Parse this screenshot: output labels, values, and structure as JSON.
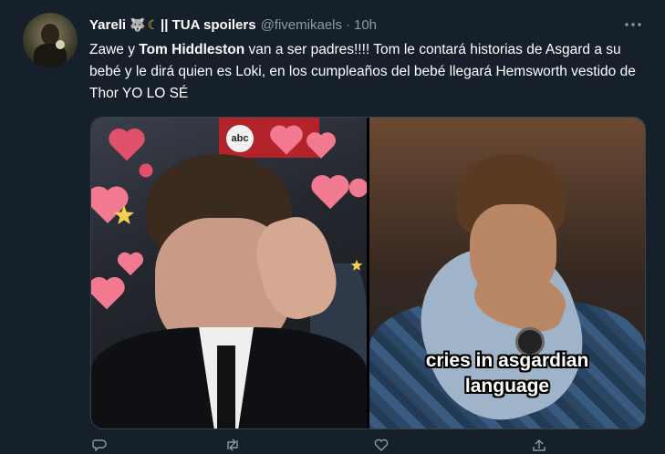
{
  "tweet": {
    "display_name": "Yareli",
    "name_suffix": "|| TUA spoilers",
    "handle": "@fivemikaels",
    "separator": "·",
    "time": "10h",
    "text": {
      "p1": "Zawe  y ",
      "bold": "Tom Hiddleston",
      "p2": " van a ser padres!!!! Tom le contará historias de Asgard a su bebé y le dirá quien es Loki, en los cumpleaños del bebé llegará Hemsworth vestido de Thor YO LO SÉ"
    }
  },
  "media": {
    "left_sign_text": "abc",
    "caption_line1": "cries in asgardian",
    "caption_line2": "language"
  },
  "icons": {
    "more": "more-icon",
    "wolf": "wolf-emoji-icon",
    "moon": "crescent-moon-emoji-icon",
    "reply": "reply-icon",
    "retweet": "retweet-icon",
    "like": "like-icon",
    "share": "share-icon"
  },
  "colors": {
    "background": "#15202b",
    "secondary_text": "#8b98a5",
    "heart": "#e0506a"
  }
}
